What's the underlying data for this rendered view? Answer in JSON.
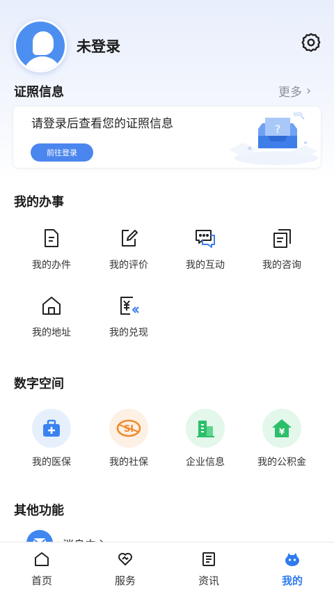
{
  "profile": {
    "username": "未登录"
  },
  "certificates": {
    "title": "证照信息",
    "more": "更多",
    "prompt": "请登录后查看您的证照信息",
    "login_button": "前往登录"
  },
  "my_affairs": {
    "title": "我的办事",
    "items": [
      {
        "label": "我的办件",
        "icon": "document-icon"
      },
      {
        "label": "我的评价",
        "icon": "edit-icon"
      },
      {
        "label": "我的互动",
        "icon": "chat-icon"
      },
      {
        "label": "我的咨询",
        "icon": "copy-icon"
      },
      {
        "label": "我的地址",
        "icon": "home-icon"
      },
      {
        "label": "我的兑现",
        "icon": "yuan-icon"
      }
    ]
  },
  "digital_space": {
    "title": "数字空间",
    "items": [
      {
        "label": "我的医保",
        "icon": "medical-kit-icon",
        "color": "#3b82f0",
        "bg": "#e6f0fd"
      },
      {
        "label": "我的社保",
        "icon": "social-security-icon",
        "color": "#f08a2a",
        "bg": "#fdf0e4"
      },
      {
        "label": "企业信息",
        "icon": "building-icon",
        "color": "#2bbf6a",
        "bg": "#e3f7eb"
      },
      {
        "label": "我的公积金",
        "icon": "housing-fund-icon",
        "color": "#2bbf6a",
        "bg": "#e3f7eb"
      }
    ]
  },
  "other": {
    "title": "其他功能",
    "items": [
      {
        "label": "消息中心",
        "icon": "message-icon"
      }
    ]
  },
  "tabbar": {
    "items": [
      {
        "label": "首页",
        "icon": "home-tab-icon"
      },
      {
        "label": "服务",
        "icon": "service-icon"
      },
      {
        "label": "资讯",
        "icon": "news-icon"
      },
      {
        "label": "我的",
        "icon": "mine-icon",
        "active": true
      }
    ],
    "active_color": "#2f7bf0"
  }
}
